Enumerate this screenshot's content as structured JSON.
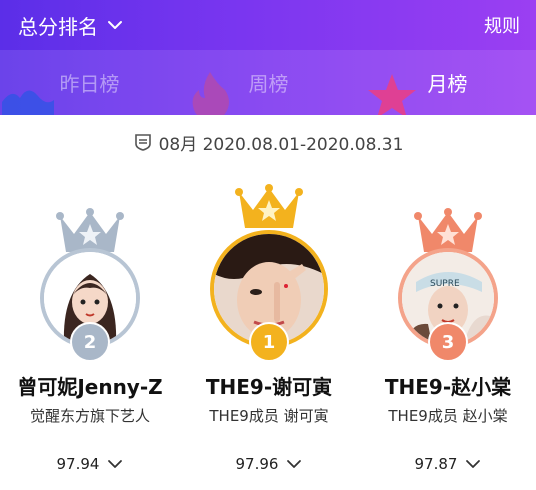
{
  "header": {
    "rank_type": "总分排名",
    "rules": "规则"
  },
  "tabs": [
    {
      "label": "昨日榜",
      "active": false
    },
    {
      "label": "周榜",
      "active": false
    },
    {
      "label": "月榜",
      "active": true
    }
  ],
  "period": "08月 2020.08.01-2020.08.31",
  "ranks": [
    {
      "rank": "2",
      "name": "曾可妮Jenny-Z",
      "subtitle": "觉醒东方旗下艺人",
      "score": "97.94",
      "color": "#a9b7c8"
    },
    {
      "rank": "1",
      "name": "THE9-谢可寅",
      "subtitle": "THE9成员 谢可寅",
      "score": "97.96",
      "color": "#f3b21e"
    },
    {
      "rank": "3",
      "name": "THE9-赵小棠",
      "subtitle": "THE9成员 赵小棠",
      "score": "97.87",
      "color": "#f0886a"
    }
  ]
}
